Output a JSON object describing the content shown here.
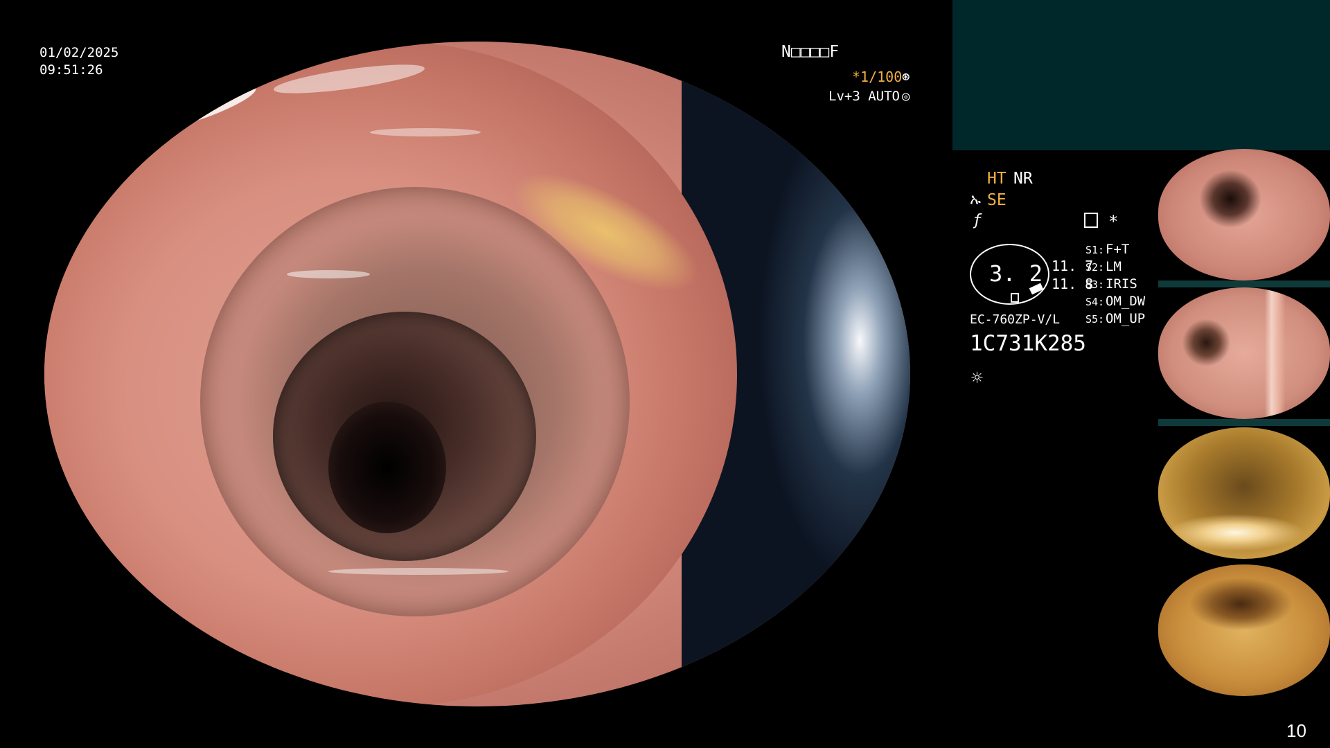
{
  "overlay": {
    "date": "01/02/2025",
    "time": "09:51:26",
    "mode_code": "N□□□□F",
    "shutter": "*1/100",
    "shutter_icon": "aperture-icon",
    "level": "Lv+3 AUTO",
    "level_icon": "target-icon"
  },
  "side_panel": {
    "ht_label": "HT",
    "nr_label": "NR",
    "se_label": "SE",
    "se_icon": "sharpness-icon",
    "f_icon": "frequency-icon",
    "memo_icon": "memo-icon",
    "asterisk": "*",
    "magnification": "3. 2",
    "values": [
      "11. 7",
      "11. 8"
    ],
    "scope_model": "EC-760ZP-V/L",
    "serial": "1C731K285",
    "light_icon": "sun-icon",
    "switches": [
      {
        "key": "S1:",
        "value": "F+T"
      },
      {
        "key": "S2:",
        "value": "LM"
      },
      {
        "key": "S3:",
        "value": "IRIS"
      },
      {
        "key": "S4:",
        "value": "OM_DW"
      },
      {
        "key": "S5:",
        "value": "OM_UP"
      }
    ]
  },
  "thumbnails": [
    {
      "label": "captured-image-1"
    },
    {
      "label": "captured-image-2"
    },
    {
      "label": "captured-image-3"
    },
    {
      "label": "captured-image-4"
    }
  ],
  "page_number": "10",
  "colors": {
    "accent_orange": "#f2b143",
    "panel_teal": "#00282a",
    "thumb_bar": "#0f3a3a"
  }
}
